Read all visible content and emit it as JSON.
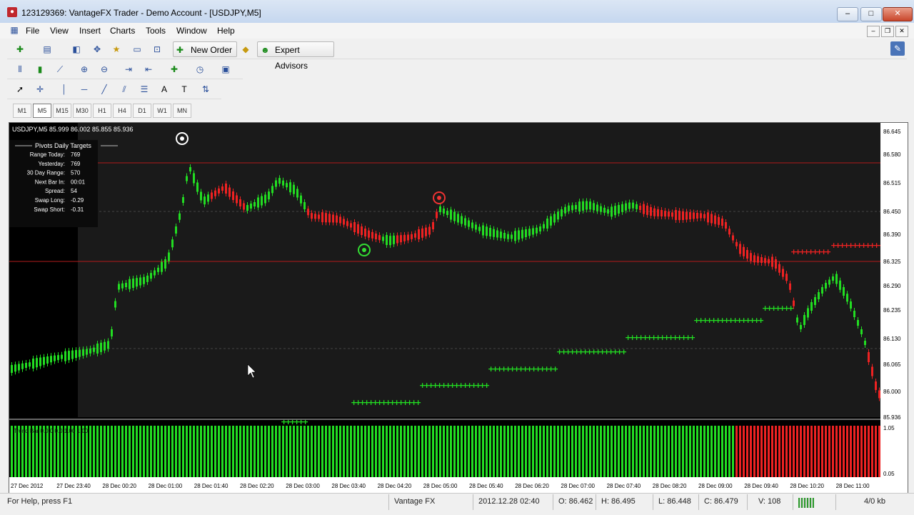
{
  "window": {
    "title": "123129369: VantageFX Trader - Demo Account - [USDJPY,M5]",
    "controls": [
      "–",
      "□",
      "✕"
    ]
  },
  "menu": [
    "File",
    "View",
    "Insert",
    "Charts",
    "Tools",
    "Window",
    "Help"
  ],
  "toolbar": {
    "new_order_label": "New Order",
    "expert_advisors_label": "Expert Advisors"
  },
  "timeframes": [
    "M1",
    "M5",
    "M15",
    "M30",
    "H1",
    "H4",
    "D1",
    "W1",
    "MN"
  ],
  "active_timeframe": "M5",
  "chart": {
    "symbol_header": "USDJPY,M5  85.999 86.002 85.855 85.936",
    "pivot_panel": {
      "title": "Pivots Daily Targets",
      "rows": [
        {
          "label": "Range  Today:",
          "value": "769"
        },
        {
          "label": "Yesterday:",
          "value": "769"
        },
        {
          "label": "30 Day Range:",
          "value": "570"
        },
        {
          "label": "Next Bar In:",
          "value": "00:01"
        },
        {
          "label": "Spread:",
          "value": "54"
        },
        {
          "label": "Swap  Long:",
          "value": "-0.29"
        },
        {
          "label": "Swap  Short:",
          "value": "-0.31"
        }
      ]
    },
    "indicator_label": "Trend Bar 0.0 0 0.0 1.00 1.00",
    "price_axis": [
      "86.645",
      "86.580",
      "86.515",
      "86.450",
      "86.390",
      "86.325",
      "86.290",
      "86.235",
      "86.130",
      "86.065",
      "86.000",
      "85.936"
    ],
    "indicator_axis": [
      "1.05",
      "0.05"
    ],
    "time_axis": [
      "27 Dec 2012",
      "27 Dec 23:40",
      "28 Dec 00:20",
      "28 Dec 01:00",
      "28 Dec 01:40",
      "28 Dec 02:20",
      "28 Dec 03:00",
      "28 Dec 03:40",
      "28 Dec 04:20",
      "28 Dec 05:00",
      "28 Dec 05:40",
      "28 Dec 06:20",
      "28 Dec 07:00",
      "28 Dec 07:40",
      "28 Dec 08:20",
      "28 Dec 09:00",
      "28 Dec 09:40",
      "28 Dec 10:20",
      "28 Dec 11:00"
    ],
    "colors": {
      "bull": "#22dd22",
      "bear": "#ee2222",
      "bg": "#000000",
      "grid": "#444444",
      "level": "#b11b1b"
    }
  },
  "status": {
    "help": "For Help, press F1",
    "profile": "Vantage FX",
    "datetime": "2012.12.28 02:40",
    "open": "O: 86.462",
    "high": "H: 86.495",
    "low": "L: 86.448",
    "close": "C: 86.479",
    "volume": "V: 108",
    "traffic": "4/0 kb"
  }
}
